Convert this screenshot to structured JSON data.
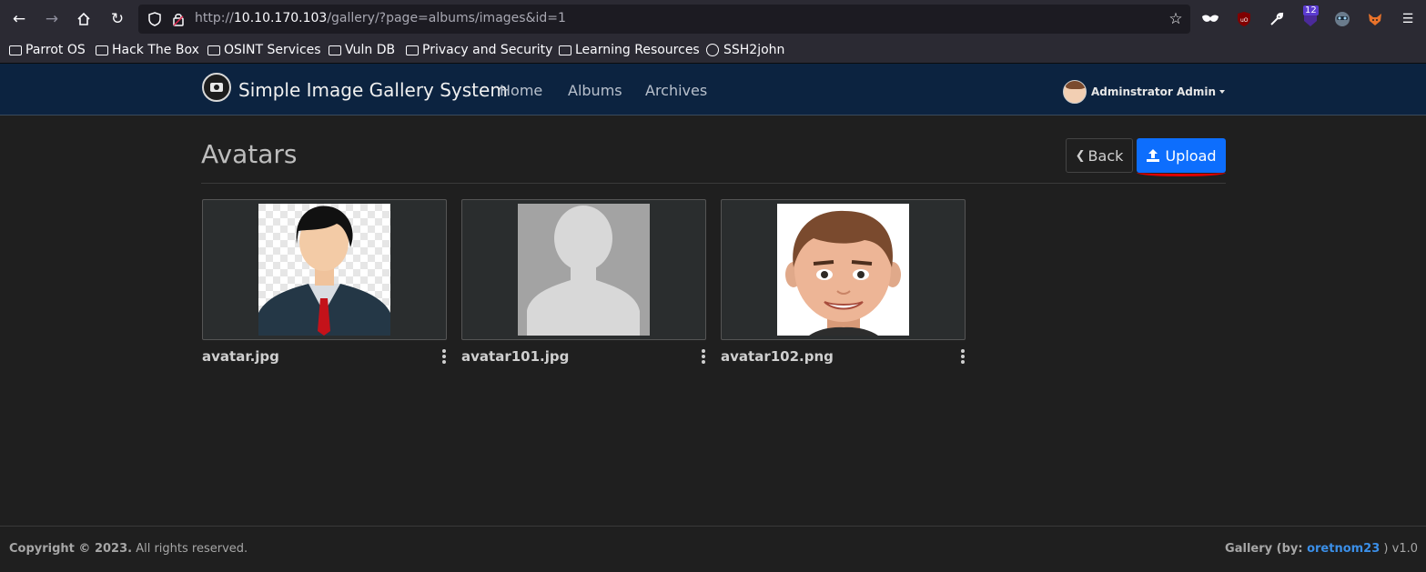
{
  "browser": {
    "url_prefix": "http://",
    "url_host": "10.10.170.103",
    "url_path": "/gallery/?page=albums/images&id=1",
    "ext_badge": "12",
    "bookmarks": [
      {
        "label": "Parrot OS",
        "icon": "folder-icon"
      },
      {
        "label": "Hack The Box",
        "icon": "folder-icon"
      },
      {
        "label": "OSINT Services",
        "icon": "folder-icon"
      },
      {
        "label": "Vuln DB",
        "icon": "folder-icon"
      },
      {
        "label": "Privacy and Security",
        "icon": "folder-icon"
      },
      {
        "label": "Learning Resources",
        "icon": "folder-icon"
      },
      {
        "label": "SSH2john",
        "icon": "globe-icon"
      }
    ]
  },
  "header": {
    "brand": "Simple Image Gallery System",
    "nav": [
      "Home",
      "Albums",
      "Archives"
    ],
    "user": "Adminstrator Admin"
  },
  "main": {
    "title": "Avatars",
    "back_label": "Back",
    "upload_label": "Upload",
    "images": [
      {
        "filename": "avatar.jpg",
        "thumb": "businessman-avatar"
      },
      {
        "filename": "avatar101.jpg",
        "thumb": "silhouette-placeholder"
      },
      {
        "filename": "avatar102.png",
        "thumb": "smiling-man-cartoon"
      }
    ]
  },
  "footer": {
    "copyright": "Copyright © 2023.",
    "rights": " All rights reserved.",
    "credit_prefix": "Gallery (by: ",
    "credit_author": "oretnom23",
    "credit_suffix": " ) ",
    "version": "v1.0"
  },
  "colors": {
    "header_bg": "#0c2340",
    "upload_btn": "#0d6efd",
    "link": "#3b8fe8",
    "annotation": "#e00000"
  }
}
